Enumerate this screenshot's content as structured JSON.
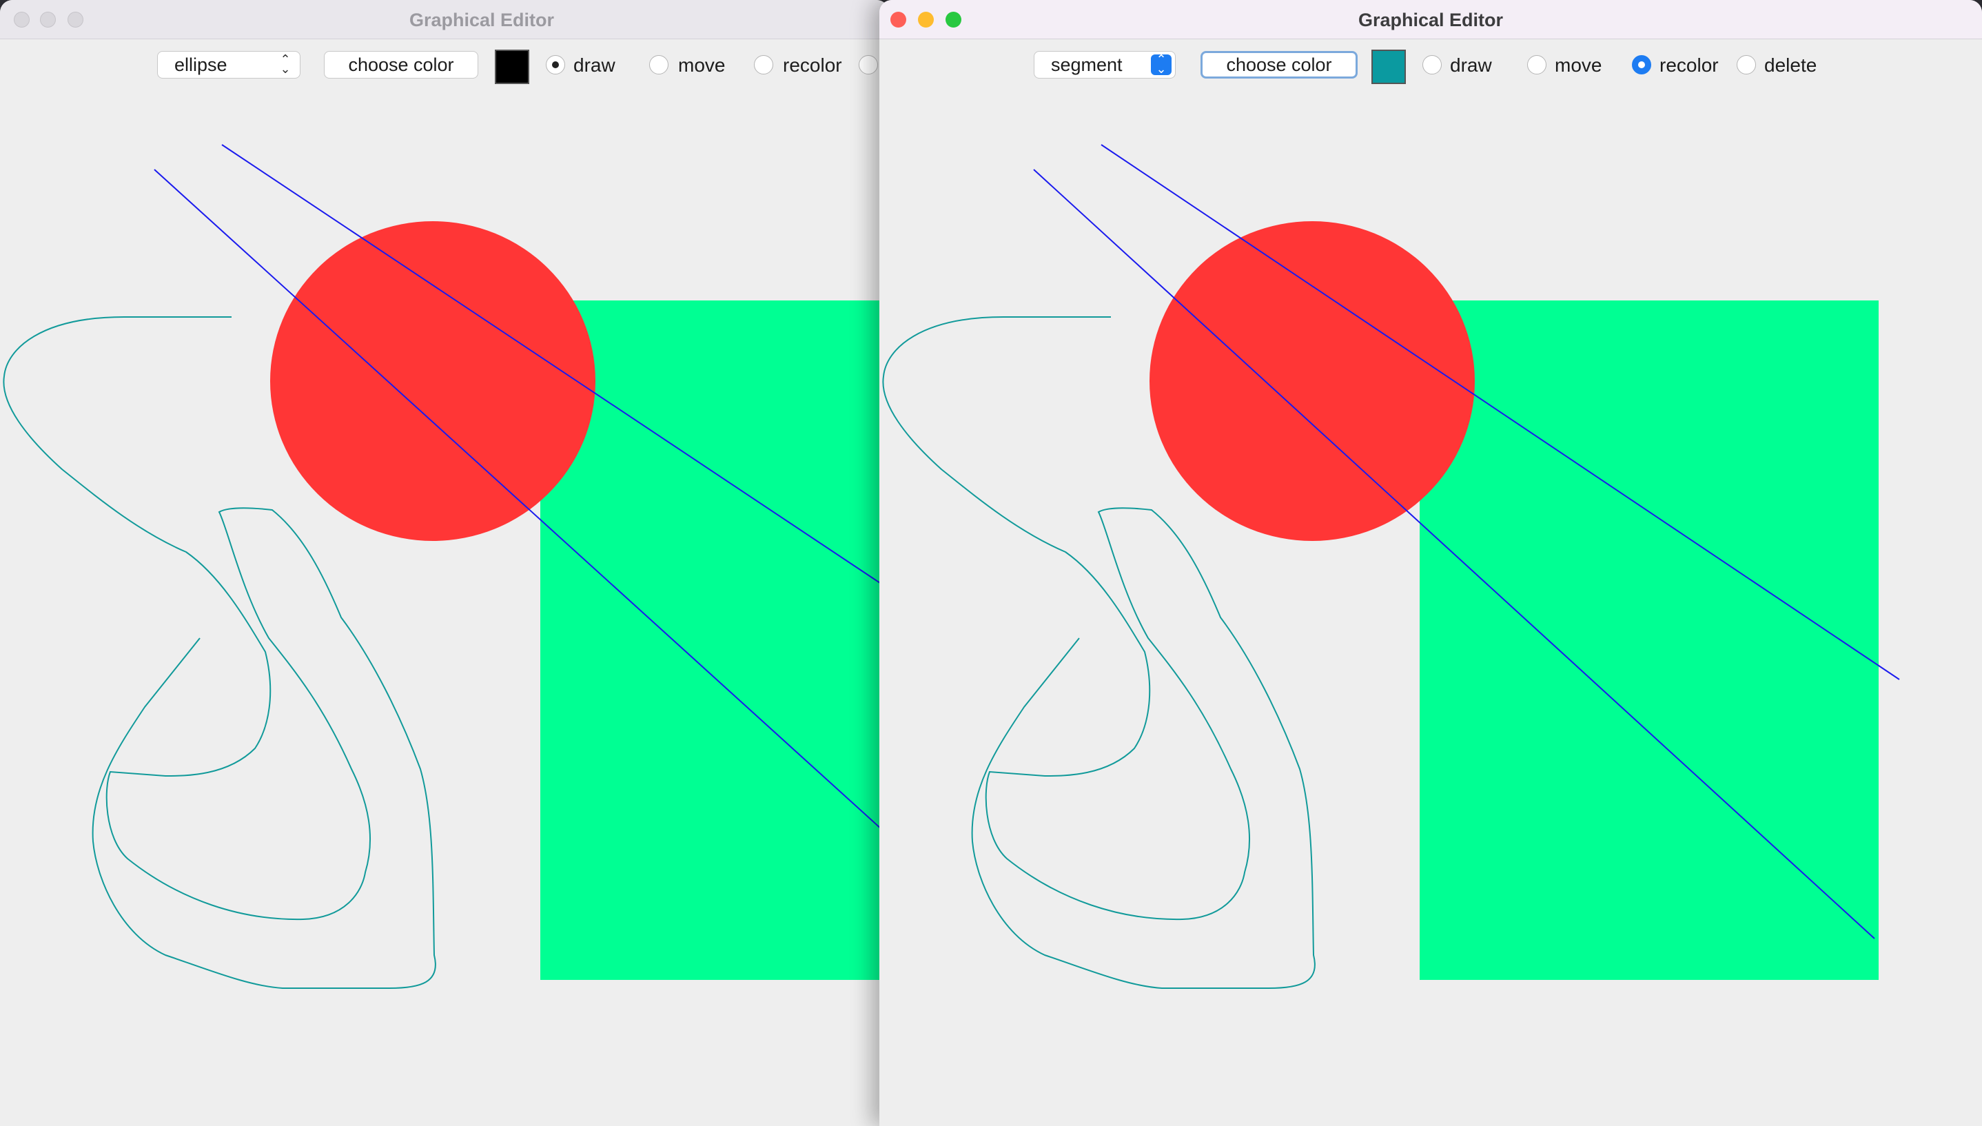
{
  "colors": {
    "circle": "#ff3636",
    "rectangle": "#00ff93",
    "segment": "#1a1aee",
    "freehand": "#119a9a",
    "back_swatch": "#000000",
    "front_swatch": "#0b9aa0",
    "close_red": "#fe5f57",
    "minimize_yellow": "#febc2e",
    "zoom_green": "#28c840"
  },
  "windows": [
    {
      "title": "Graphical Editor",
      "shape_select": "ellipse",
      "choose_color_label": "choose color",
      "modes": {
        "draw": "draw",
        "move": "move",
        "recolor": "recolor"
      },
      "selected_mode": "draw",
      "active": false
    },
    {
      "title": "Graphical Editor",
      "shape_select": "segment",
      "choose_color_label": "choose color",
      "modes": {
        "draw": "draw",
        "move": "move",
        "recolor": "recolor",
        "delete": "delete"
      },
      "selected_mode": "recolor",
      "active": true
    }
  ],
  "icons": {
    "select_arrows": "up-down-chevron-icon",
    "window_controls": [
      "close-icon",
      "minimize-icon",
      "zoom-icon"
    ]
  }
}
